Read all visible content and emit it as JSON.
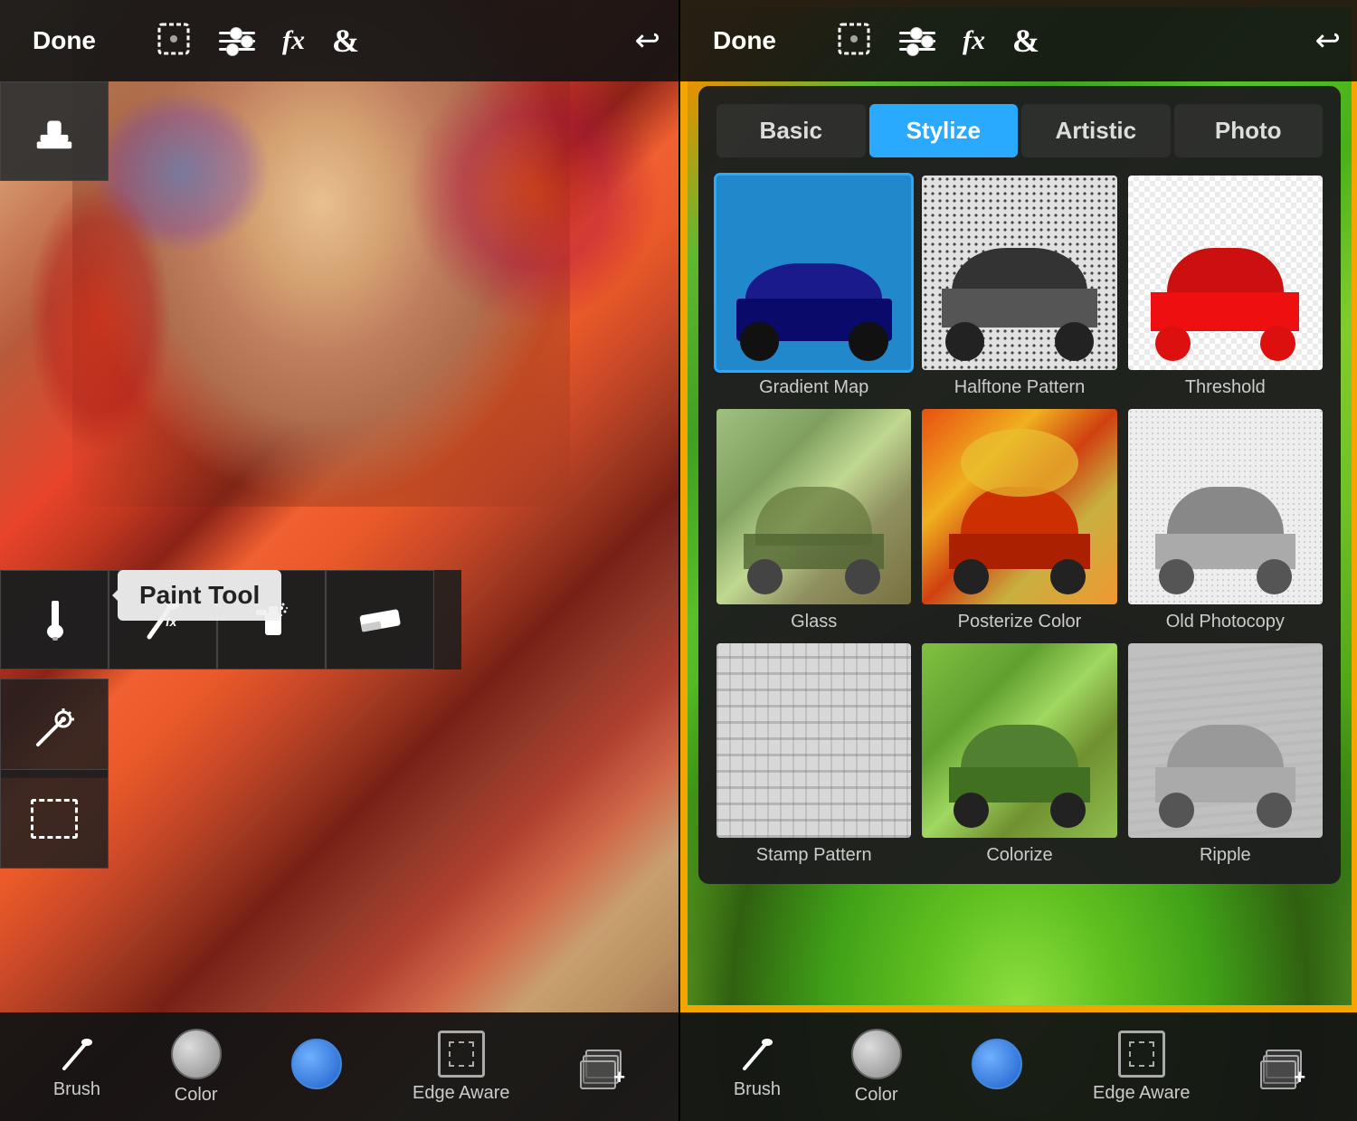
{
  "left": {
    "top_toolbar": {
      "done_label": "Done",
      "undo_label": "↩"
    },
    "tooltip": {
      "paint_tool_label": "Paint Tool"
    },
    "tools": {
      "stamp_icon": "✦",
      "brush_icon": "✏",
      "fx_brush": "fx",
      "spray_bottle": "🧴",
      "eraser": "▭",
      "magic_wand": "✳",
      "lasso": "▢"
    },
    "bottom_toolbar": {
      "brush_label": "Brush",
      "color_label": "Color",
      "edge_aware_label": "Edge Aware",
      "layers_label": "+"
    }
  },
  "right": {
    "top_toolbar": {
      "done_label": "Done",
      "undo_label": "↩"
    },
    "effects_panel": {
      "tabs": [
        {
          "label": "Basic",
          "active": false
        },
        {
          "label": "Stylize",
          "active": true
        },
        {
          "label": "Artistic",
          "active": false
        },
        {
          "label": "Photo",
          "active": false
        }
      ],
      "filters": [
        {
          "label": "Gradient Map",
          "selected": true,
          "thumb": "gradient-map"
        },
        {
          "label": "Halftone Pattern",
          "selected": false,
          "thumb": "halftone"
        },
        {
          "label": "Threshold",
          "selected": false,
          "thumb": "threshold"
        },
        {
          "label": "Glass",
          "selected": false,
          "thumb": "glass"
        },
        {
          "label": "Posterize Color",
          "selected": false,
          "thumb": "posterize"
        },
        {
          "label": "Old Photocopy",
          "selected": false,
          "thumb": "old-photocopy"
        },
        {
          "label": "Stamp Pattern",
          "selected": false,
          "thumb": "stamp"
        },
        {
          "label": "Colorize",
          "selected": false,
          "thumb": "colorize"
        },
        {
          "label": "Ripple",
          "selected": false,
          "thumb": "ripple"
        }
      ]
    },
    "bottom_toolbar": {
      "brush_label": "Brush",
      "color_label": "Color",
      "edge_aware_label": "Edge Aware",
      "layers_label": "+"
    }
  }
}
